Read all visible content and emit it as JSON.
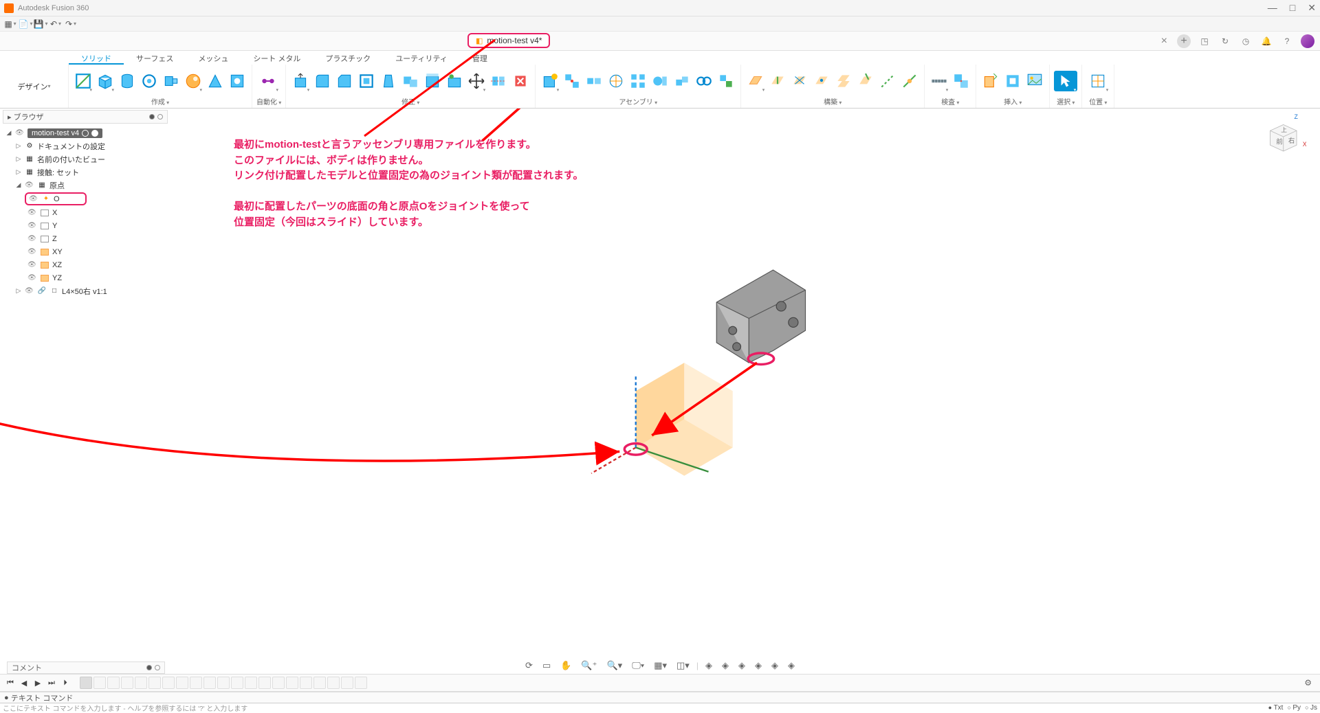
{
  "app": {
    "title": "Autodesk Fusion 360"
  },
  "document": {
    "tab_label": "motion-test v4*"
  },
  "quickaccess": {
    "items": [
      "grid",
      "file",
      "save",
      "undo",
      "redo"
    ]
  },
  "topbar_right": {
    "close": "×",
    "plus": "+",
    "icons": [
      "ext",
      "refresh",
      "clock",
      "bell",
      "help"
    ]
  },
  "design_menu": "デザイン",
  "ribbon_tabs": [
    "ソリッド",
    "サーフェス",
    "メッシュ",
    "シート メタル",
    "プラスチック",
    "ユーティリティ",
    "管理"
  ],
  "ribbon_active_tab": 0,
  "ribbon_groups": {
    "create": "作成",
    "auto": "自動化",
    "modify": "修正",
    "assembly": "アセンブリ",
    "construct": "構築",
    "inspect": "検査",
    "insert": "挿入",
    "select": "選択",
    "pos": "位置"
  },
  "browser": {
    "title": "ブラウザ",
    "root": "motion-test v4",
    "nodes": {
      "doc_settings": "ドキュメントの設定",
      "named_views": "名前の付いたビュー",
      "contact_sets": "接触: セット",
      "origin": "原点",
      "axes": [
        "O",
        "X",
        "Y",
        "Z",
        "XY",
        "XZ",
        "YZ"
      ],
      "component": "L4×50右 v1:1"
    }
  },
  "annotations": {
    "a1_l1": "最初にmotion-testと言うアッセンブリ専用ファイルを作ります。",
    "a1_l2": "このファイルには、ボディは作りません。",
    "a1_l3": "リンク付け配置したモデルと位置固定の為のジョイント類が配置されます。",
    "a2_l1": "最初に配置したパーツの底面の角と原点Oをジョイントを使って",
    "a2_l2": "位置固定（今回はスライド）しています。"
  },
  "viewcube": {
    "front": "前",
    "top": "上",
    "right": "右",
    "z": "Z",
    "x": "X"
  },
  "comment_panel": "コメント",
  "navbar_items": [
    "orbit",
    "look",
    "pan",
    "zoom",
    "fit",
    "display",
    "grid",
    "effects",
    "c1",
    "c2",
    "c3",
    "c4",
    "c5",
    "c6"
  ],
  "timeline": {
    "controls": [
      "⏮",
      "◀",
      "▶",
      "⏭",
      "⏵"
    ],
    "nodes": 21,
    "gear": "⚙"
  },
  "cmd": {
    "header": "テキスト コマンド",
    "placeholder": "ここにテキスト コマンドを入力します - ヘルプを参照するには '?' と入力します",
    "modes": [
      "Txt",
      "Py",
      "Js"
    ],
    "mode_sel": 0
  }
}
